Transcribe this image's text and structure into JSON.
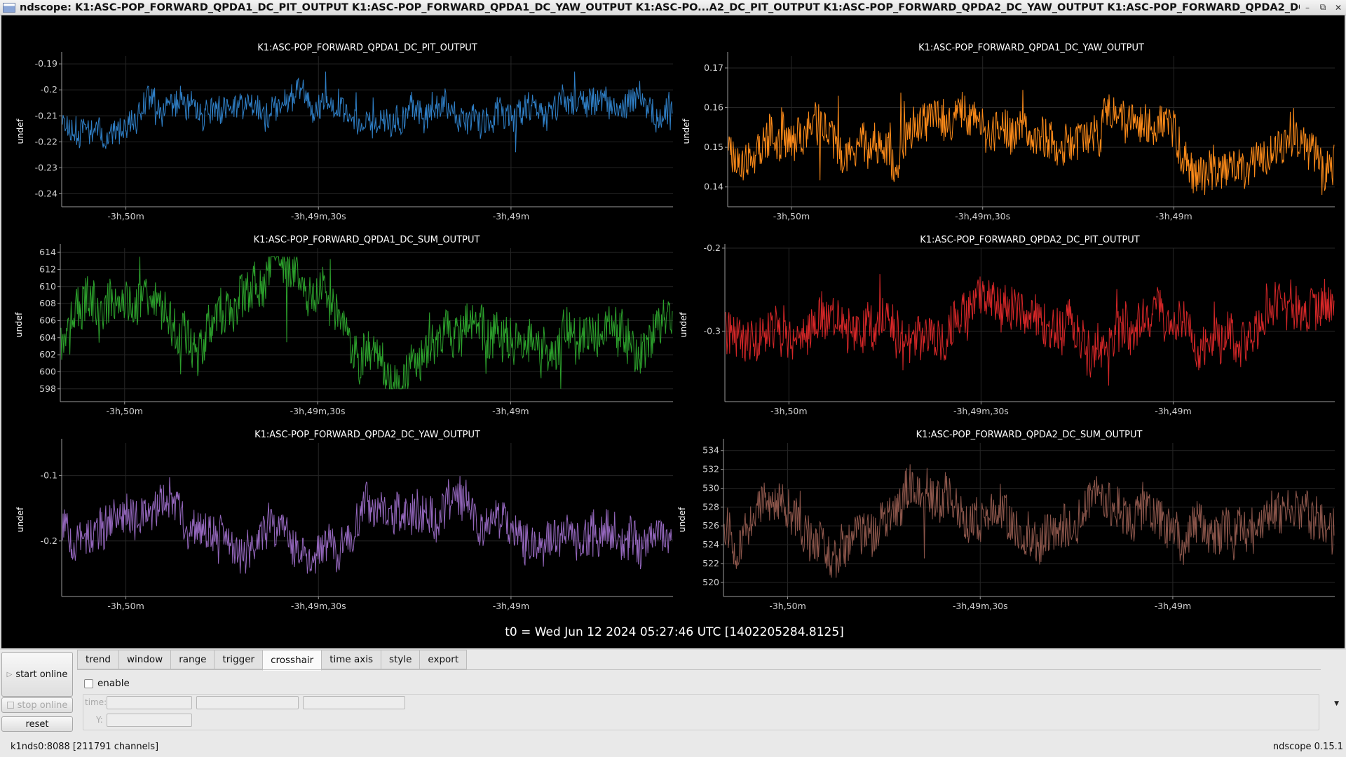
{
  "window": {
    "title": "ndscope: K1:ASC-POP_FORWARD_QPDA1_DC_PIT_OUTPUT K1:ASC-POP_FORWARD_QPDA1_DC_YAW_OUTPUT K1:ASC-PO...A2_DC_PIT_OUTPUT K1:ASC-POP_FORWARD_QPDA2_DC_YAW_OUTPUT K1:ASC-POP_FORWARD_QPDA2_DC_SUM_OUTPUT",
    "btn_minimize": "–",
    "btn_restore": "⧉",
    "btn_close": "✕"
  },
  "t0_label": "t0 = Wed Jun 12 2024 05:27:46 UTC [1402205284.8125]",
  "chart_data": [
    {
      "type": "line",
      "title": "K1:ASC-POP_FORWARD_QPDA1_DC_PIT_OUTPUT",
      "ylabel": "undef",
      "color": "#2f7fc6",
      "ylim": [
        -0.245,
        -0.187
      ],
      "yticks": [
        -0.19,
        -0.2,
        -0.21,
        -0.22,
        -0.23,
        -0.24
      ],
      "ytick_labels": [
        "-0.19",
        "-0.2",
        "-0.21",
        "-0.22",
        "-0.23",
        "-0.24"
      ],
      "xticks": [
        "-3h,50m",
        "-3h,49m,30s",
        "-3h,49m"
      ],
      "y_range": [
        -0.224,
        -0.193
      ],
      "y_center": -0.208,
      "seed": 11
    },
    {
      "type": "line",
      "title": "K1:ASC-POP_FORWARD_QPDA1_DC_YAW_OUTPUT",
      "ylabel": "undef",
      "color": "#ff8c1a",
      "ylim": [
        0.135,
        0.173
      ],
      "yticks": [
        0.17,
        0.16,
        0.15,
        0.14
      ],
      "ytick_labels": [
        "0.17",
        "0.16",
        "0.15",
        "0.14"
      ],
      "xticks": [
        "-3h,50m",
        "-3h,49m,30s",
        "-3h,49m"
      ],
      "y_range": [
        0.138,
        0.167
      ],
      "y_center": 0.152,
      "seed": 23
    },
    {
      "type": "line",
      "title": "K1:ASC-POP_FORWARD_QPDA1_DC_SUM_OUTPUT",
      "ylabel": "undef",
      "color": "#2ca02c",
      "ylim": [
        596.5,
        614.5
      ],
      "yticks": [
        614,
        612,
        610,
        608,
        606,
        604,
        602,
        600,
        598
      ],
      "ytick_labels": [
        "614",
        "612",
        "610",
        "608",
        "606",
        "604",
        "602",
        "600",
        "598"
      ],
      "xticks": [
        "-3h,50m",
        "-3h,49m,30s",
        "-3h,49m"
      ],
      "y_range": [
        598,
        613.5
      ],
      "y_center": 606,
      "seed": 37
    },
    {
      "type": "line",
      "title": "K1:ASC-POP_FORWARD_QPDA2_DC_PIT_OUTPUT",
      "ylabel": "undef",
      "color": "#d62728",
      "ylim": [
        -0.385,
        -0.2
      ],
      "yticks": [
        -0.2,
        -0.3
      ],
      "ytick_labels": [
        "-0.2",
        "-0.3"
      ],
      "xticks": [
        "-3h,50m",
        "-3h,49m,30s",
        "-3h,49m"
      ],
      "y_range": [
        -0.37,
        -0.22
      ],
      "y_center": -0.3,
      "seed": 41
    },
    {
      "type": "line",
      "title": "K1:ASC-POP_FORWARD_QPDA2_DC_YAW_OUTPUT",
      "ylabel": "undef",
      "color": "#9467bd",
      "ylim": [
        -0.285,
        -0.05
      ],
      "yticks": [
        -0.1,
        -0.2
      ],
      "ytick_labels": [
        "-0.1",
        "-0.2"
      ],
      "xticks": [
        "-3h,50m",
        "-3h,49m,30s",
        "-3h,49m"
      ],
      "y_range": [
        -0.25,
        -0.07
      ],
      "y_center": -0.17,
      "seed": 53
    },
    {
      "type": "line",
      "title": "K1:ASC-POP_FORWARD_QPDA2_DC_SUM_OUTPUT",
      "ylabel": "undef",
      "color": "#8c564b",
      "ylim": [
        518.5,
        534.8
      ],
      "yticks": [
        534,
        532,
        530,
        528,
        526,
        524,
        522,
        520
      ],
      "ytick_labels": [
        "534",
        "532",
        "530",
        "528",
        "526",
        "524",
        "522",
        "520"
      ],
      "xticks": [
        "-3h,50m",
        "-3h,49m,30s",
        "-3h,49m"
      ],
      "y_range": [
        520.5,
        533.5
      ],
      "y_center": 527.5,
      "seed": 67
    }
  ],
  "controls": {
    "start_online": "start online",
    "stop_online": "stop online",
    "reset": "reset",
    "tabs": [
      "trend",
      "window",
      "range",
      "trigger",
      "crosshair",
      "time axis",
      "style",
      "export"
    ],
    "active_tab": "crosshair",
    "crosshair": {
      "enable_label": "enable",
      "enabled": false,
      "time_label": "time:",
      "y_label": "Y:"
    }
  },
  "status": {
    "server": "k1nds0:8088  [211791 channels]",
    "version": "ndscope 0.15.1"
  }
}
